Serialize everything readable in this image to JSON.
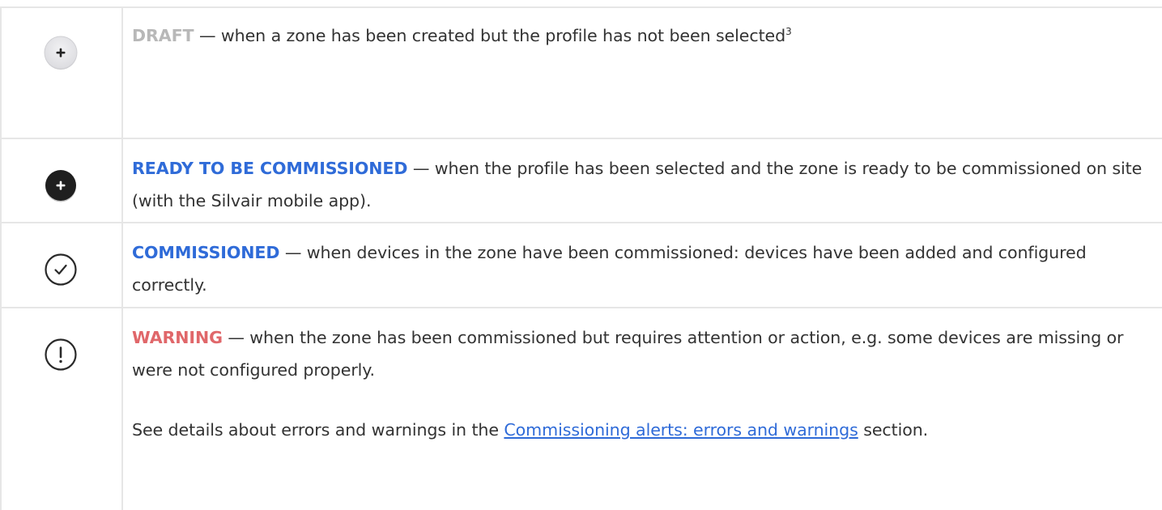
{
  "rows": [
    {
      "icon": "plus-light-circle-icon",
      "label": "DRAFT",
      "text": " — when a zone has been created but the profile has not been selected",
      "footnote": "3"
    },
    {
      "icon": "plus-dark-circle-icon",
      "label": "READY TO BE COMMISSIONED",
      "text": " — when the profile has been selected and the zone is ready to be commissioned on site (with the Silvair mobile app)."
    },
    {
      "icon": "check-circle-icon",
      "label": "COMMISSIONED",
      "text": " — when devices in the zone have been commissioned: devices have been added and configured correctly."
    },
    {
      "icon": "exclamation-circle-icon",
      "label": "WARNING",
      "text": " — when the zone has been commissioned but requires attention or action, e.g. some devices are missing or were not configured properly.",
      "see_prefix": "See details about errors and warnings in the ",
      "see_link": "Commissioning alerts: errors and warnings",
      "see_suffix": " section."
    }
  ],
  "colors": {
    "draft": "#b8b8b8",
    "blue": "#2f6bd8",
    "warning": "#e0676a",
    "text": "#333333",
    "border": "#e6e6e6"
  }
}
